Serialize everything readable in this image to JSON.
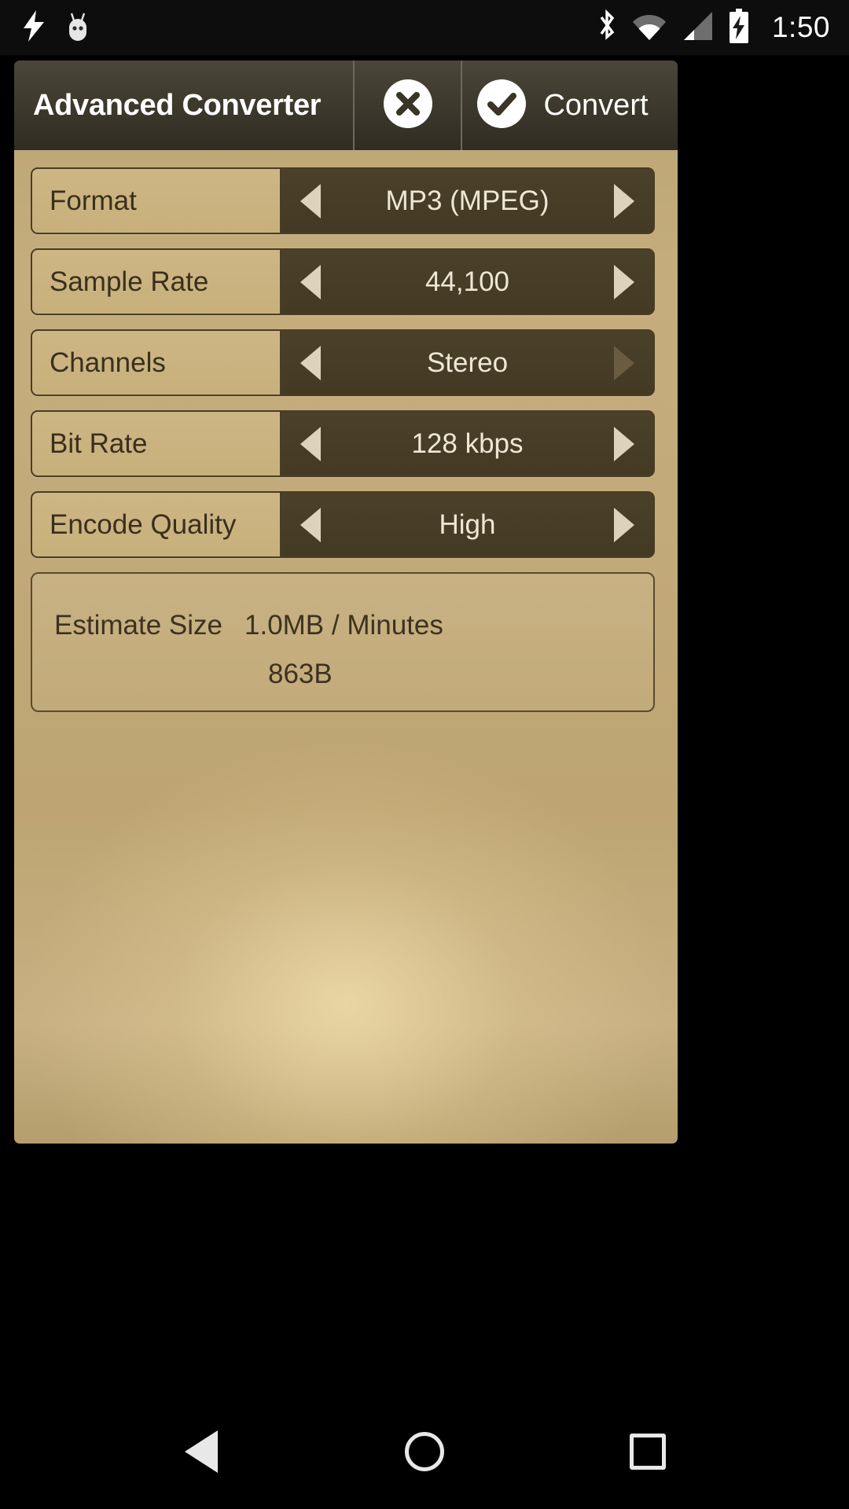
{
  "status_bar": {
    "clock": "1:50",
    "left_icons": [
      "charging-bolt-icon",
      "cyanogenmod-android-icon"
    ],
    "right_icons": [
      "bluetooth-icon",
      "wifi-icon",
      "cellular-signal-icon",
      "battery-charging-icon"
    ]
  },
  "title_bar": {
    "app_title": "Advanced Converter",
    "cancel_icon": "close-circle-icon",
    "convert_icon": "check-circle-icon",
    "convert_label": "Convert"
  },
  "settings": [
    {
      "label": "Format",
      "value": "MP3 (MPEG)",
      "left_arrow_enabled": true,
      "right_arrow_enabled": true
    },
    {
      "label": "Sample Rate",
      "value": "44,100",
      "left_arrow_enabled": true,
      "right_arrow_enabled": true
    },
    {
      "label": "Channels",
      "value": "Stereo",
      "left_arrow_enabled": true,
      "right_arrow_enabled": false
    },
    {
      "label": "Bit Rate",
      "value": "128 kbps",
      "left_arrow_enabled": true,
      "right_arrow_enabled": true
    },
    {
      "label": "Encode Quality",
      "value": "High",
      "left_arrow_enabled": true,
      "right_arrow_enabled": true
    }
  ],
  "estimate": {
    "label": "Estimate Size",
    "value_line1": "1.0MB / Minutes",
    "value_line2": "863B"
  },
  "nav_bar": {
    "back_label": "back-icon",
    "home_label": "home-icon",
    "recents_label": "recents-icon"
  },
  "colors": {
    "panel_gold": "#c2a97a",
    "row_dark": "#453b25",
    "row_label_tan": "#cbb380",
    "title_bar_dark": "#3e3a2e",
    "arrow_light": "#ddd2ba",
    "arrow_dim": "#6a5c40",
    "status_bar_black": "#0d0d0d"
  }
}
